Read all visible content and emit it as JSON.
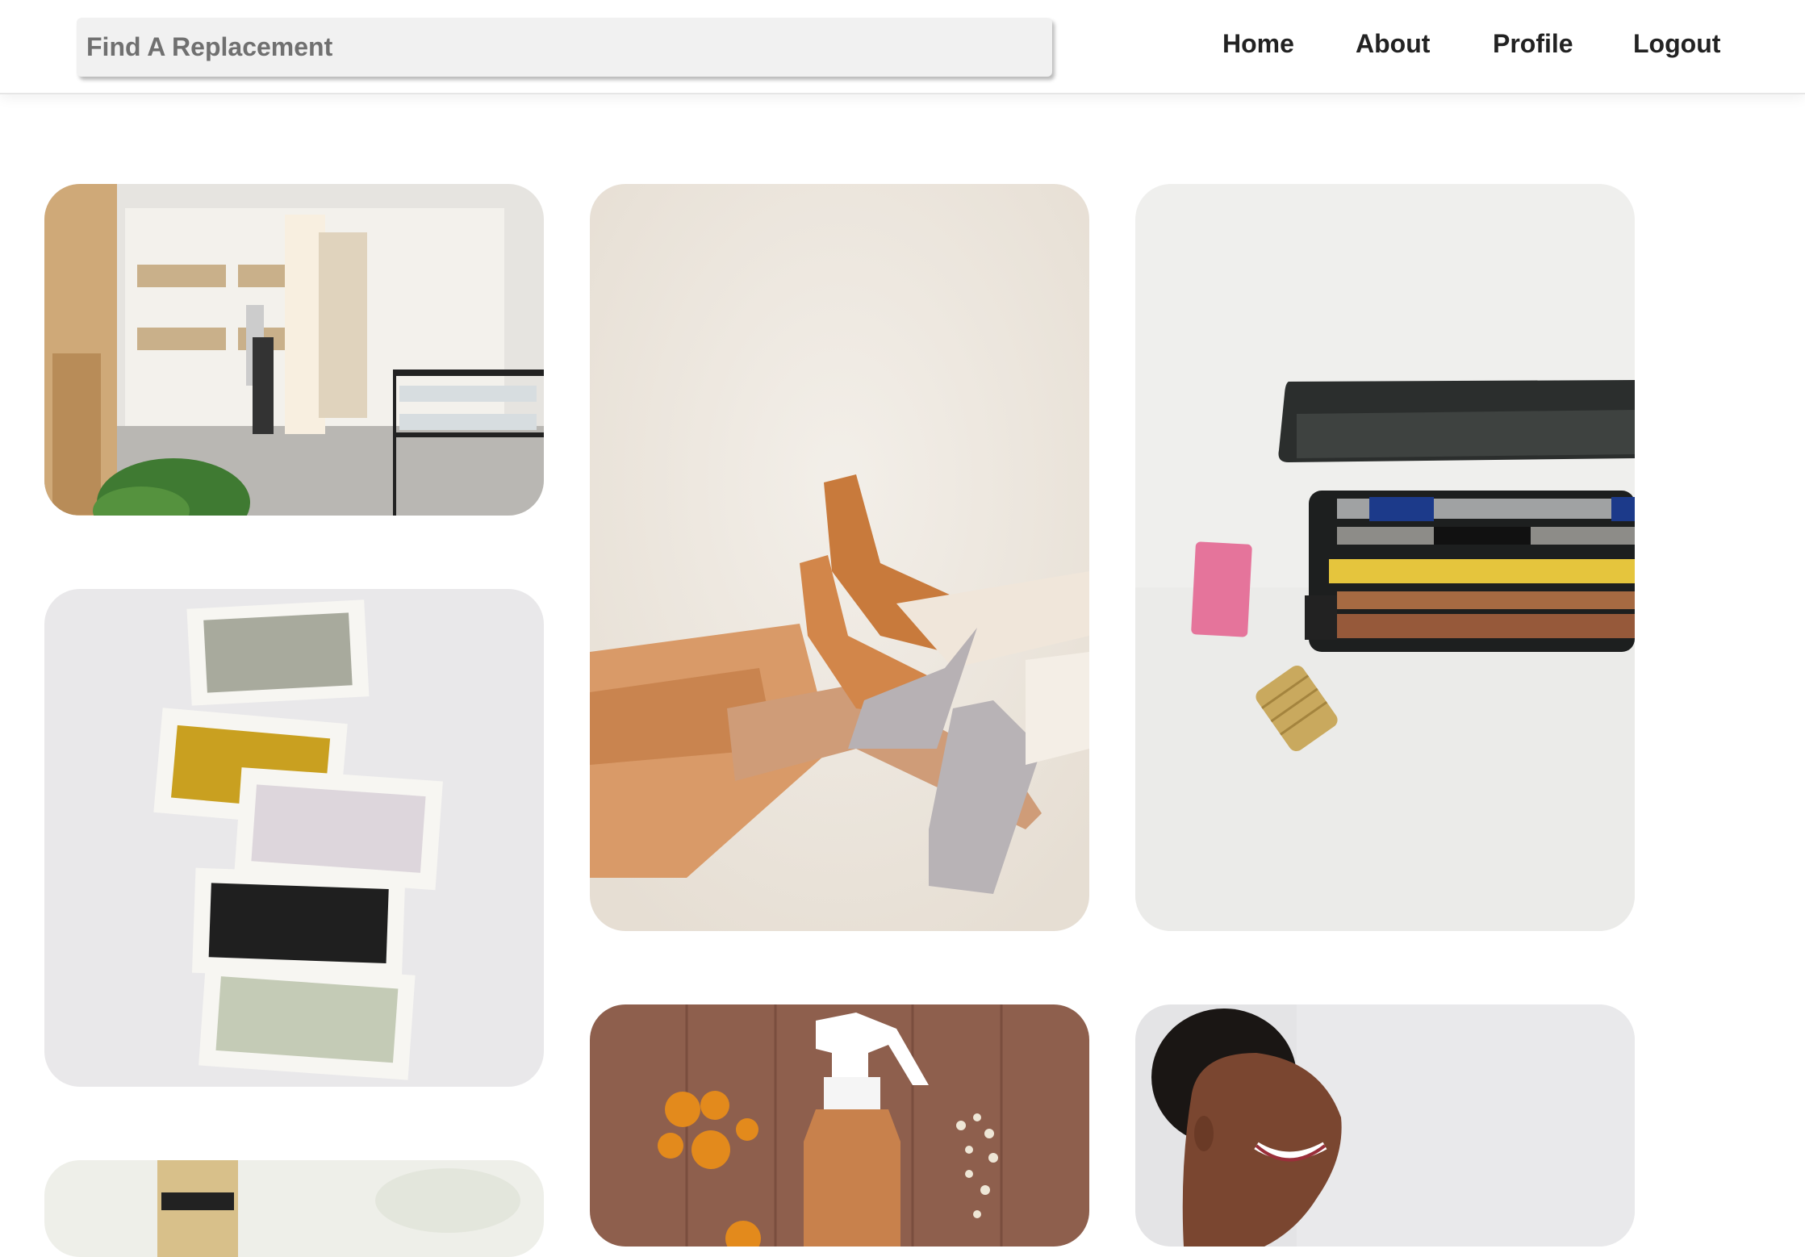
{
  "search": {
    "placeholder": "Find A Replacement"
  },
  "nav": {
    "home": "Home",
    "about": "About",
    "profile": "Profile",
    "logout": "Logout"
  },
  "cards": [
    {
      "photo": "refill-store-interior"
    },
    {
      "photo": "fabric-swatches"
    },
    {
      "photo": "bottle"
    },
    {
      "photo": "suede-heels-legs"
    },
    {
      "photo": "spray-bottle-orange-peels"
    },
    {
      "photo": "pencil-tin-case"
    },
    {
      "photo": "smiling-woman"
    }
  ]
}
